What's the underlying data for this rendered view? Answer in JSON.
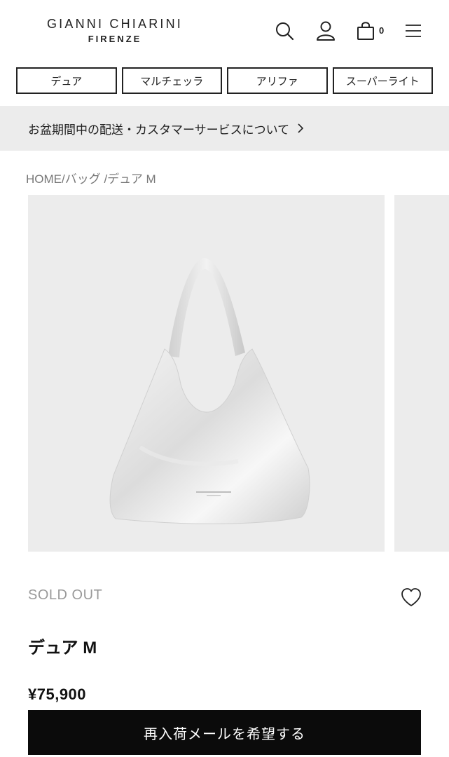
{
  "brand": {
    "name": "GIANNI CHIARINI",
    "sub": "FIRENZE"
  },
  "header": {
    "icons": [
      "search-icon",
      "user-icon",
      "shopping-bag-icon",
      "menu-icon"
    ],
    "cart_count": "0"
  },
  "category_nav": {
    "items": [
      {
        "label": "デュア"
      },
      {
        "label": "マルチェッラ"
      },
      {
        "label": "アリファ"
      },
      {
        "label": "スーパーライト"
      }
    ]
  },
  "notice": {
    "text": "お盆期間中の配送・カスタマーサービスについて"
  },
  "breadcrumb": {
    "text": "HOME/バッグ /デュア M"
  },
  "product": {
    "status": "SOLD OUT",
    "name": "デュア M",
    "price": "¥75,900",
    "restock_button": "再入荷メールを希望する"
  },
  "colors": {
    "accent": "#0b0b0b",
    "gallery_bg": "#ececec",
    "notice_bg": "#ececec",
    "muted_text": "#9a9a9a"
  }
}
